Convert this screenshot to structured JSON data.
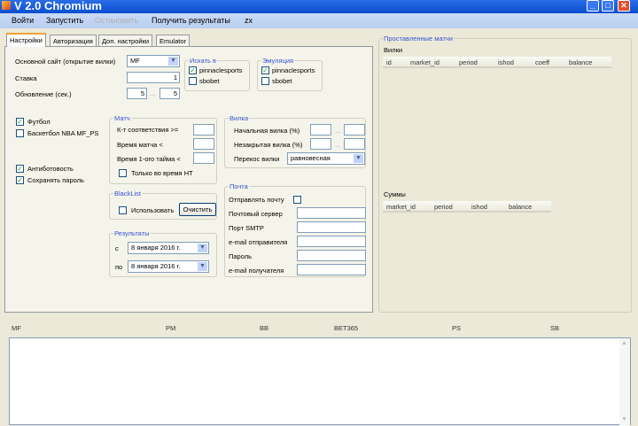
{
  "window": {
    "title": "V 2.0 Chromium"
  },
  "menu": [
    "Войти",
    "Запустить",
    "Остановить",
    "Получить результаты",
    "zx"
  ],
  "tabs": [
    "Настройки",
    "Авторизация",
    "Доп. настройки",
    "Emulator"
  ],
  "settings": {
    "main_site_label": "Основной сайт (открытие вилки)",
    "main_site_value": "MF",
    "stake_label": "Ставка",
    "stake_value": "1",
    "refresh_label": "Обновление (сек.)",
    "refresh_from": "5",
    "refresh_sep": "...",
    "refresh_to": "5",
    "search_in": {
      "title": "Искать в",
      "items": [
        {
          "label": "pinnaclesports",
          "checked": true
        },
        {
          "label": "sbobet",
          "checked": false
        }
      ]
    },
    "emulation": {
      "title": "Эмуляция",
      "items": [
        {
          "label": "pinnaclesports",
          "checked": true
        },
        {
          "label": "sbobet",
          "checked": false
        }
      ]
    },
    "football": "Футбол",
    "basketball": "Баскетбол NBA MF_PS",
    "antibot": "Антиботовость",
    "save_password": "Сохранять пароль",
    "match": {
      "title": "Матч",
      "coef": "К-т соответствия >=",
      "match_time": "Время матча <",
      "first_half": "Время 1-ого тайма <",
      "ht_only": "Только во время HT"
    },
    "fork": {
      "title": "Вилка",
      "initial": "Начальная вилка (%)",
      "unclosed": "Незакрытая вилка (%)",
      "skew": "Перекос вилки",
      "skew_value": "равновесная",
      "sep": "..."
    },
    "blacklist": {
      "title": "BlackList",
      "use": "Использовать",
      "clear": "Очистить"
    },
    "results": {
      "title": "Результаты",
      "from_label": "с",
      "from_date": "8  января  2016 г.",
      "to_label": "по",
      "to_date": "8  января  2016 г."
    },
    "mail": {
      "title": "Почта",
      "send": "Отправлять почту",
      "server": "Почтовый сервер",
      "port": "Порт SMTP",
      "sender": "e-mail отправителя",
      "password": "Пароль",
      "recipient": "e-mail получателя"
    }
  },
  "placed": {
    "title": "Проставленные матчи",
    "forks_label": "Вилки",
    "forks_columns": [
      "id",
      "market_id",
      "period",
      "ishod",
      "coeff",
      "balance"
    ],
    "sums_label": "Суммы",
    "sums_columns": [
      "market_id",
      "period",
      "ishod",
      "balance"
    ]
  },
  "bottom_columns": [
    "MF",
    "PM",
    "BB",
    "BET365",
    "PS",
    "SB"
  ]
}
